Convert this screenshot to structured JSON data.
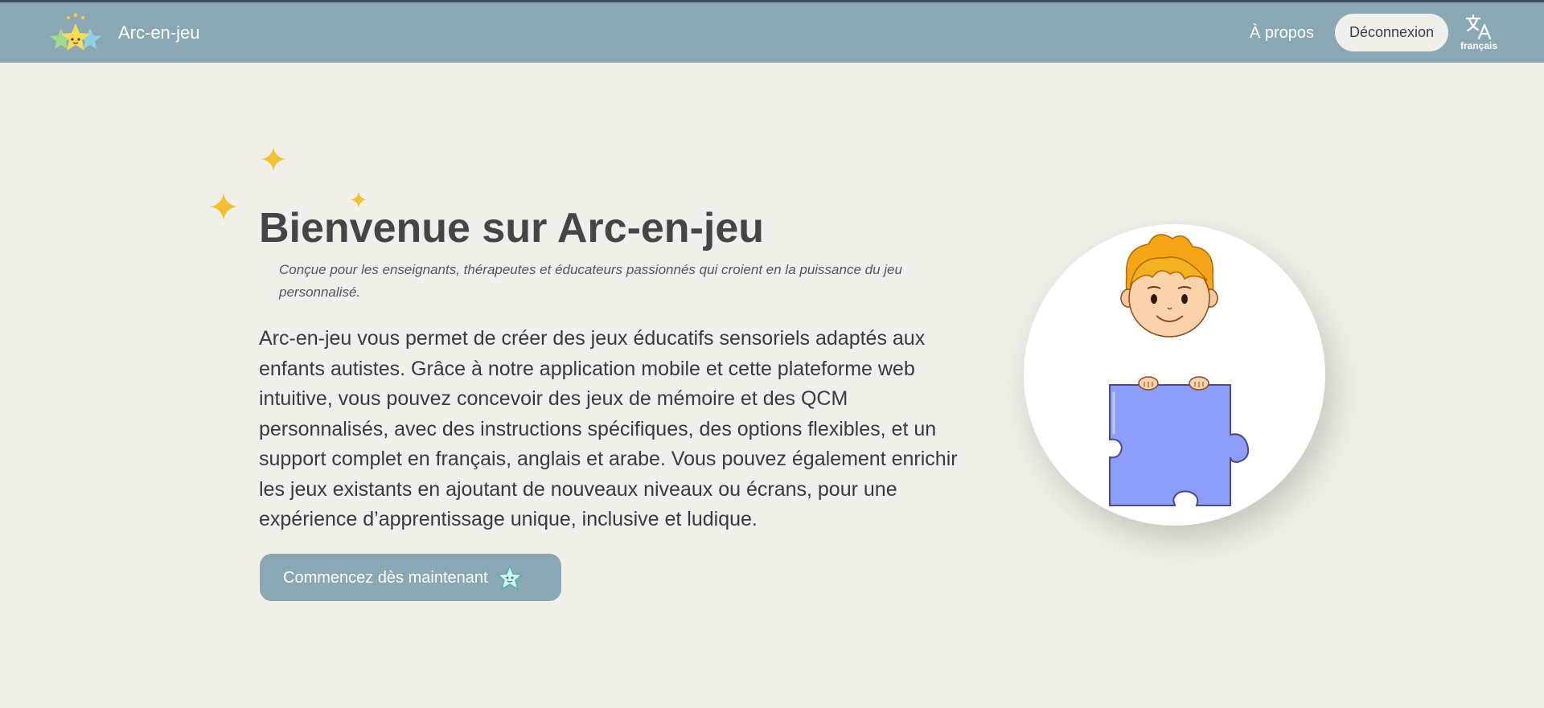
{
  "navbar": {
    "brand": "Arc-en-jeu",
    "about_label": "À propos",
    "logout_label": "Déconnexion",
    "language_label": "français"
  },
  "hero": {
    "title": "Bienvenue sur Arc-en-jeu",
    "subtitle": "Conçue pour les enseignants, thérapeutes et éducateurs passionnés qui croient en la puissance du jeu personnalisé.",
    "description": "Arc-en-jeu vous permet de créer des jeux éducatifs sensoriels adaptés aux enfants autistes. Grâce à notre application mobile et cette plateforme web intuitive, vous pouvez concevoir des jeux de mémoire et des QCM personnalisés, avec des instructions spécifiques, des options flexibles, et un support complet en français, anglais et arabe. Vous pouvez également enrichir les jeux existants en ajoutant de nouveaux niveaux ou écrans, pour une expérience d’apprentissage unique, inclusive et ludique.",
    "cta_label": "Commencez dès maintenant"
  },
  "icons": {
    "logo": "rainbow-stars-logo",
    "language": "translate-icon",
    "sparkles": "sparkle-icon",
    "cta": "star-icon",
    "illustration": "boy-with-puzzle-piece"
  },
  "colors": {
    "navbar": "#8aa8b3",
    "background": "#f0efe9",
    "sparkle": "#f2c12e",
    "puzzle": "#8c9dfa",
    "text": "#3f3f3f"
  }
}
